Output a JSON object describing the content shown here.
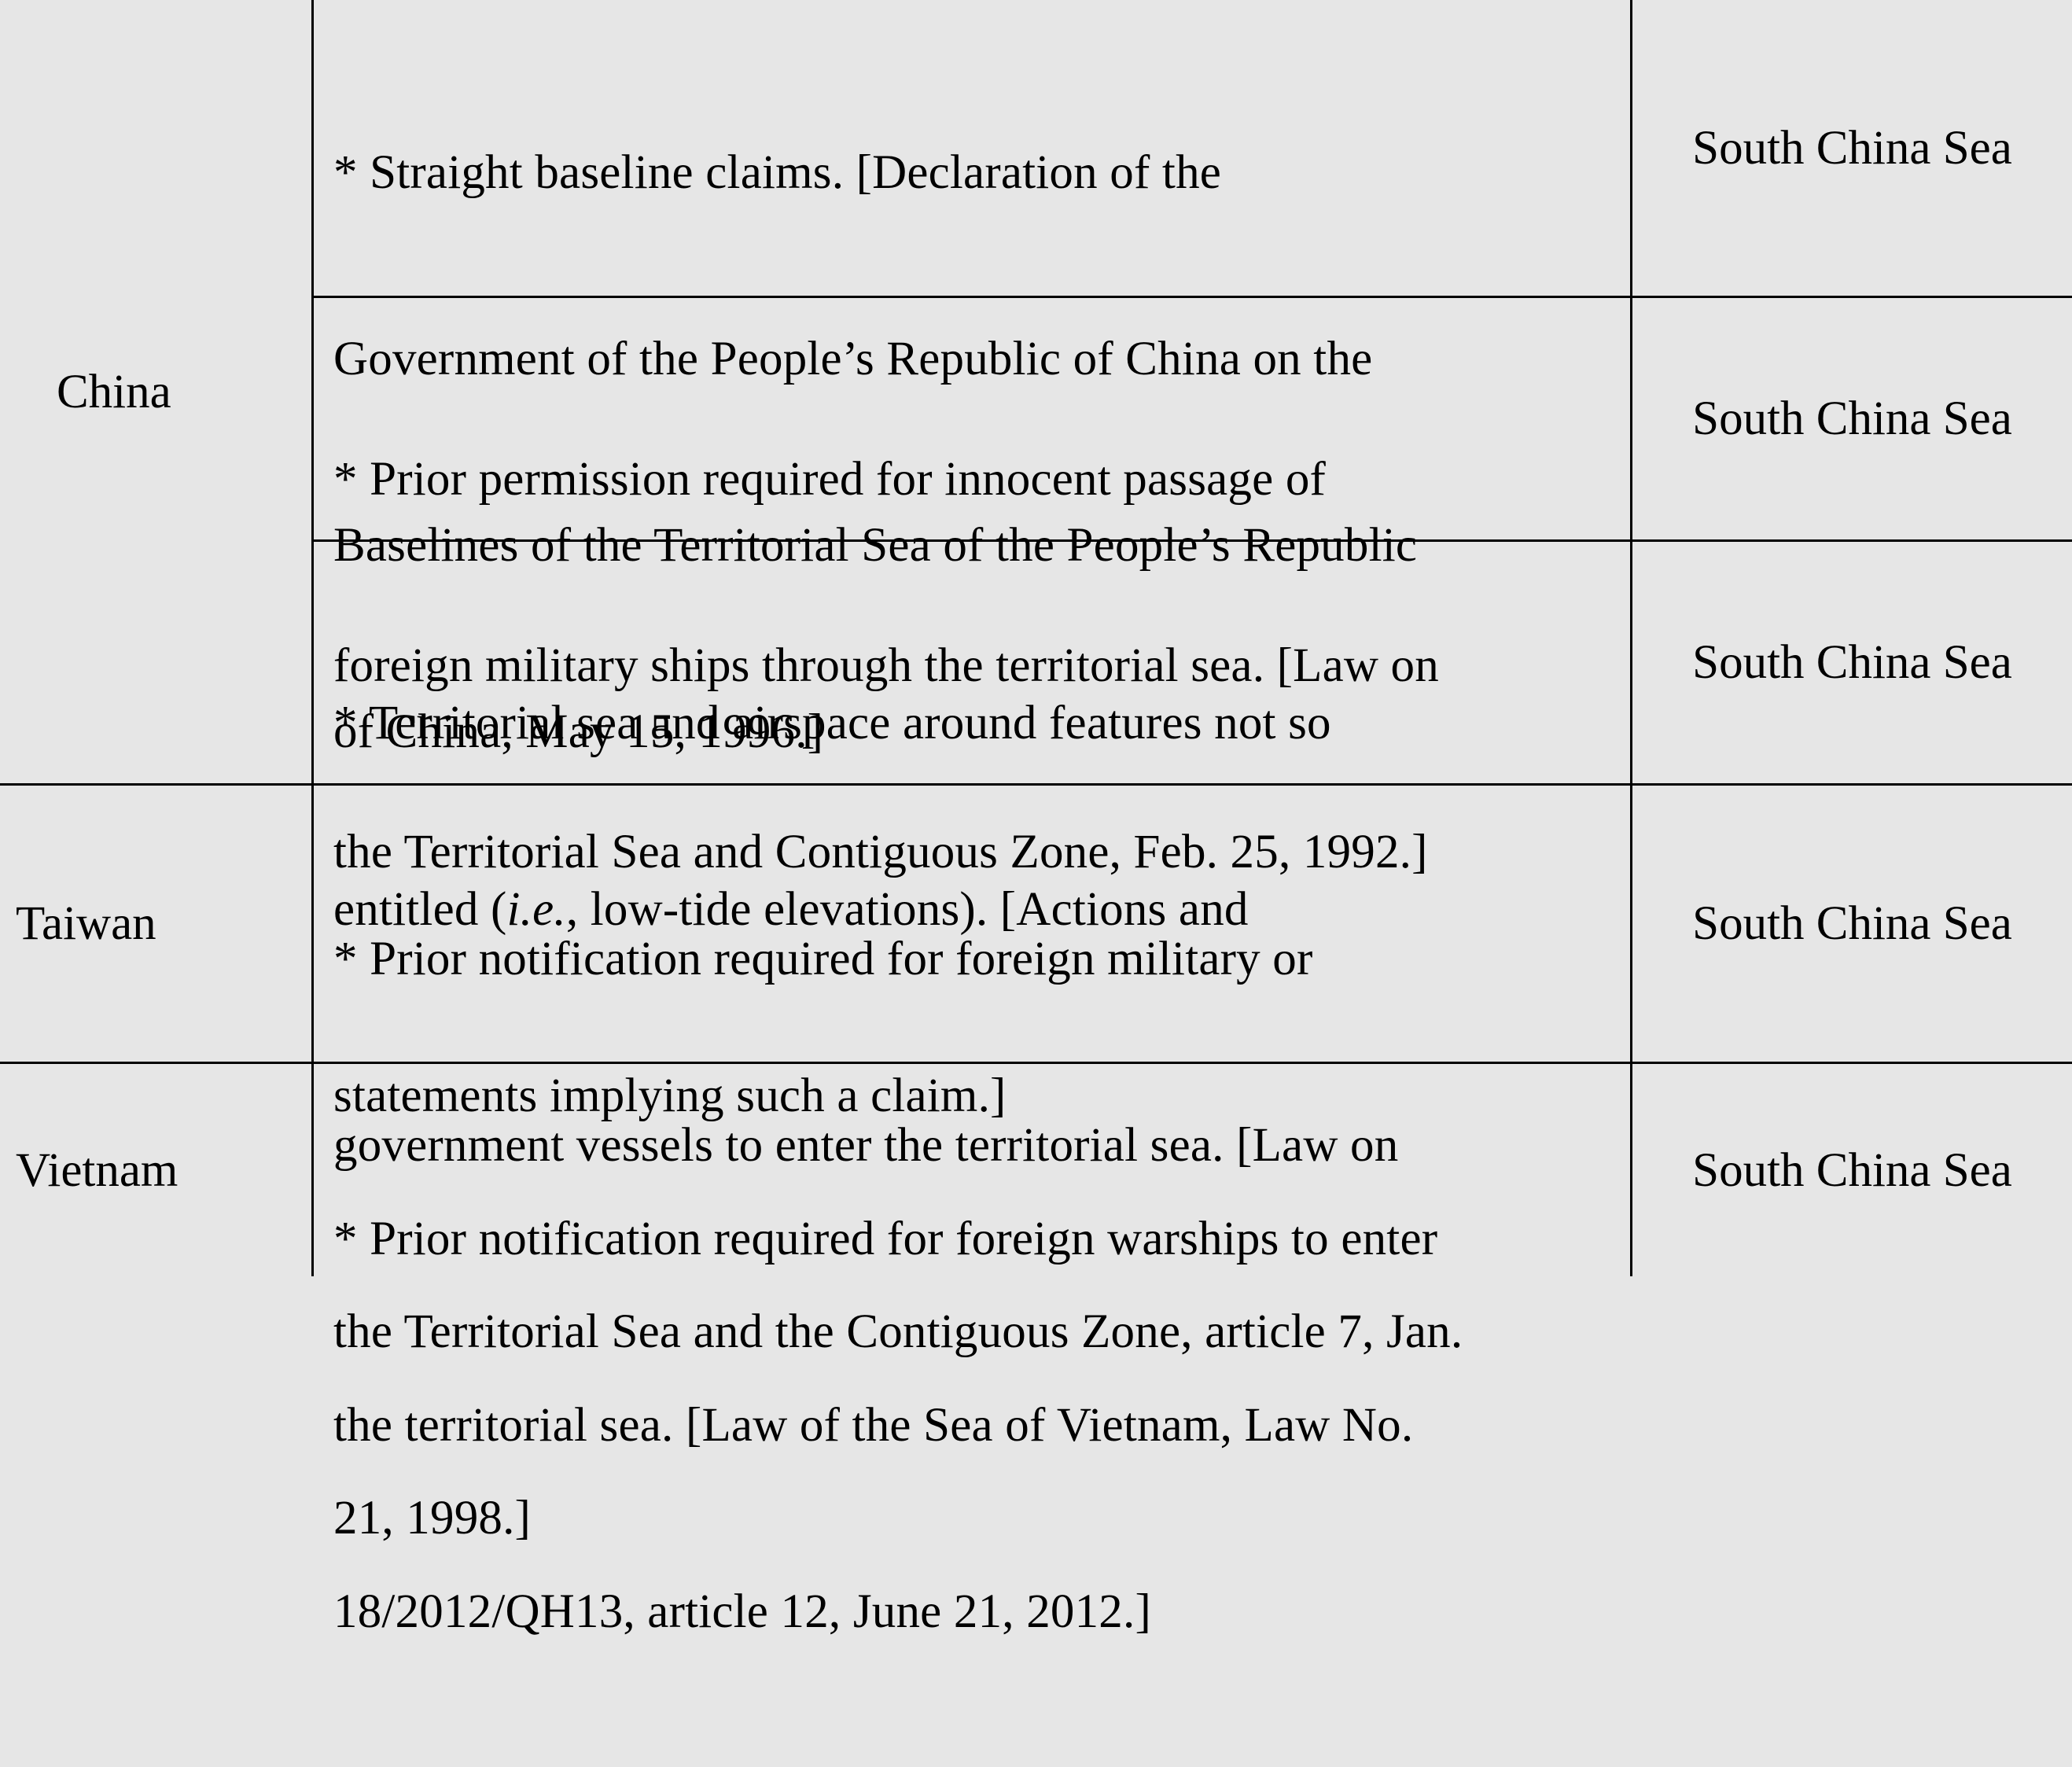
{
  "table": {
    "groups": [
      {
        "country": "China",
        "rows": [
          {
            "description": [
              "* Straight baseline claims.  [Declaration of the",
              "Government of the People’s Republic of China on the",
              "Baselines of the Territorial Sea of the People’s Republic",
              "of China, May 15, 1996.]"
            ],
            "region": "South China Sea"
          },
          {
            "description": [
              "* Prior permission required for innocent passage of",
              "foreign military ships through the territorial sea.  [Law on",
              "the Territorial Sea and Contiguous Zone, Feb. 25, 1992.]"
            ],
            "region": "South China Sea"
          },
          {
            "description": {
              "line1": "* Territorial sea and airspace around features not so",
              "line2_pre": "entitled (",
              "line2_italic": "i.e.",
              "line2_post": ", low-tide elevations).  [Actions and",
              "line3": "statements implying such a claim.]"
            },
            "region": "South China Sea"
          }
        ]
      },
      {
        "country": "Taiwan",
        "rows": [
          {
            "description": [
              "* Prior notification required for foreign military or",
              "government vessels to enter the territorial sea.  [Law on",
              "the Territorial Sea and the Contiguous Zone, article 7, Jan.",
              "21, 1998.]"
            ],
            "region": "South China Sea"
          }
        ]
      },
      {
        "country": "Vietnam",
        "rows": [
          {
            "description": [
              "* Prior notification required for foreign warships to enter",
              "the territorial sea.  [Law of the Sea of Vietnam, Law No.",
              "18/2012/QH13, article 12, June 21, 2012.]"
            ],
            "region": "South China Sea"
          }
        ]
      }
    ]
  }
}
